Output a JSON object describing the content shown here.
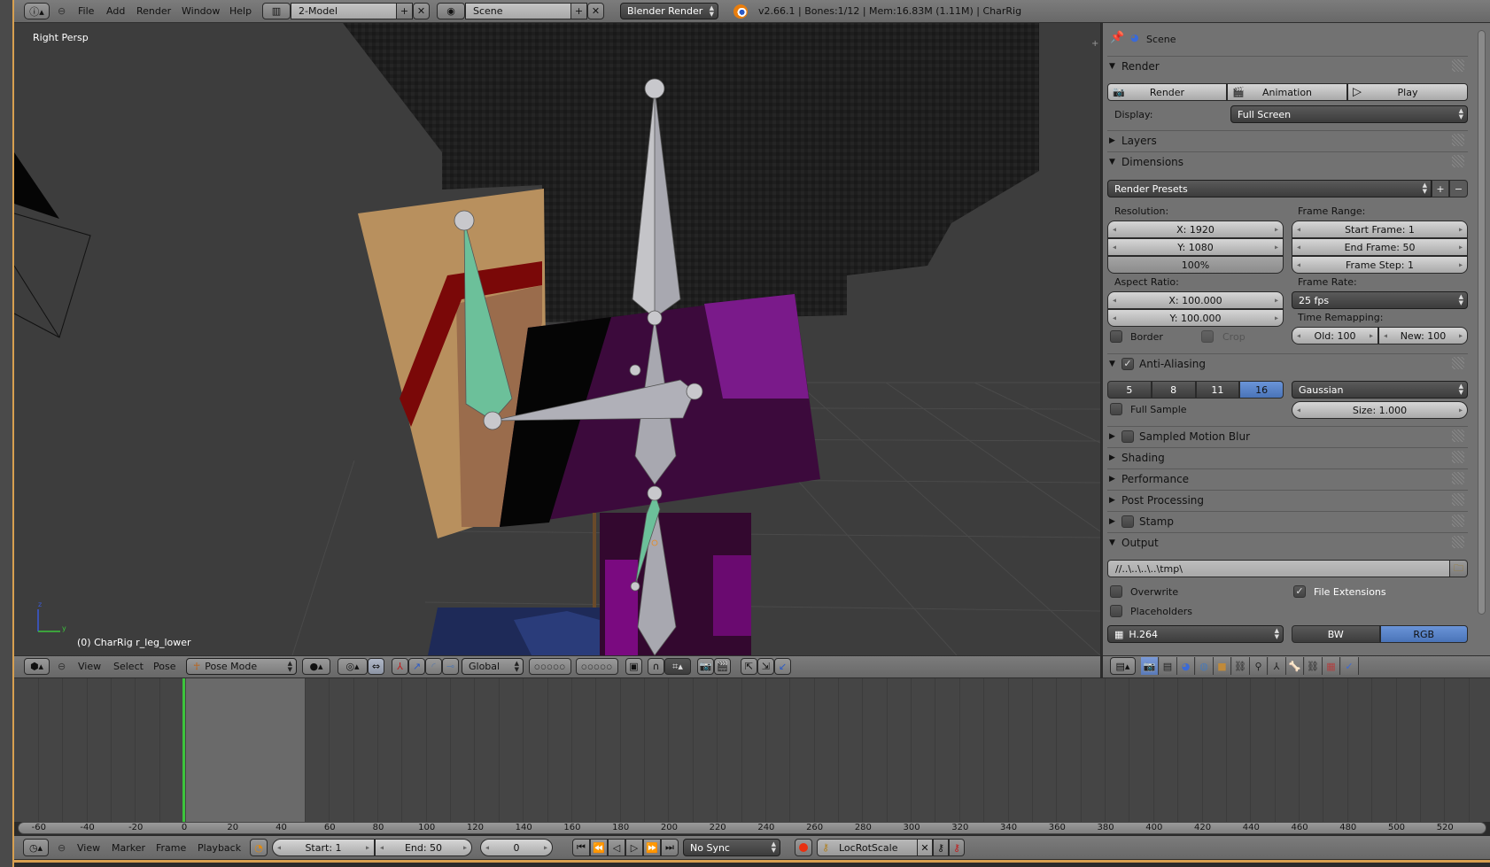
{
  "topbar": {
    "menus": [
      "File",
      "Add",
      "Render",
      "Window",
      "Help"
    ],
    "screen_layout": "2-Model",
    "scene": "Scene",
    "render_engine": "Blender Render",
    "status": "v2.66.1 | Bones:1/12  | Mem:16.83M (1.11M) | CharRig"
  },
  "viewport": {
    "view_name": "Right Persp",
    "active_info": "(0) CharRig r_leg_lower",
    "axis_labels": {
      "z": "z",
      "y": "y"
    },
    "header": {
      "menus": [
        "View",
        "Select",
        "Pose"
      ],
      "mode": "Pose Mode",
      "orientation": "Global"
    }
  },
  "properties": {
    "context": "Scene",
    "render": {
      "title": "Render",
      "buttons": [
        "Render",
        "Animation",
        "Play"
      ],
      "display_label": "Display:",
      "display_value": "Full Screen"
    },
    "layers": "Layers",
    "dimensions": {
      "title": "Dimensions",
      "presets": "Render Presets",
      "resolution_label": "Resolution:",
      "res_x": "X: 1920",
      "res_y": "Y: 1080",
      "res_pct": "100%",
      "frame_range_label": "Frame Range:",
      "start_frame": "Start Frame: 1",
      "end_frame": "End Frame: 50",
      "frame_step": "Frame Step: 1",
      "aspect_label": "Aspect Ratio:",
      "aspect_x": "X: 100.000",
      "aspect_y": "Y: 100.000",
      "frame_rate_label": "Frame Rate:",
      "frame_rate": "25 fps",
      "time_remap_label": "Time Remapping:",
      "old": "Old: 100",
      "new": "New: 100",
      "border": "Border",
      "border_checked": false,
      "crop": "Crop",
      "crop_checked": false
    },
    "anti_aliasing": {
      "title": "Anti-Aliasing",
      "enabled": true,
      "samples": [
        "5",
        "8",
        "11",
        "16"
      ],
      "selected_sample": "16",
      "filter": "Gaussian",
      "full_sample": "Full Sample",
      "full_sample_checked": false,
      "size": "Size: 1.000"
    },
    "collapsed_sections": [
      {
        "title": "Sampled Motion Blur",
        "checkbox": true
      },
      {
        "title": "Shading",
        "checkbox": false
      },
      {
        "title": "Performance",
        "checkbox": false
      },
      {
        "title": "Post Processing",
        "checkbox": false
      },
      {
        "title": "Stamp",
        "checkbox": true
      }
    ],
    "output": {
      "title": "Output",
      "path": "//..\\..\\..\\..\\tmp\\",
      "overwrite": "Overwrite",
      "overwrite_checked": false,
      "file_extensions": "File Extensions",
      "file_extensions_checked": true,
      "placeholders": "Placeholders",
      "placeholders_checked": false,
      "format": "H.264",
      "color_modes": [
        "BW",
        "RGB"
      ],
      "selected_color_mode": "RGB"
    },
    "tabs": [
      "render",
      "render-layers",
      "scene",
      "world",
      "object",
      "constraints",
      "modifiers",
      "data",
      "bone",
      "bone-constraints",
      "texture",
      "particles"
    ],
    "active_tab": "render"
  },
  "timeline": {
    "ruler_labels": [
      "-60",
      "-40",
      "-20",
      "0",
      "20",
      "40",
      "60",
      "80",
      "100",
      "120",
      "140",
      "160",
      "180",
      "200",
      "220",
      "240",
      "260",
      "280",
      "300",
      "320",
      "340",
      "360",
      "380",
      "400",
      "420",
      "440",
      "460",
      "480",
      "500",
      "520"
    ],
    "current_frame_value": 0,
    "range": [
      1,
      50
    ],
    "header": {
      "menus": [
        "View",
        "Marker",
        "Frame",
        "Playback"
      ],
      "start": "Start: 1",
      "end": "End: 50",
      "current": "0",
      "sync": "No Sync",
      "keying_set": "LocRotScale"
    }
  },
  "colors": {
    "accent_blue": "#5680c2",
    "playhead": "#3cc43c",
    "bone_selected": "#6cc09a"
  }
}
